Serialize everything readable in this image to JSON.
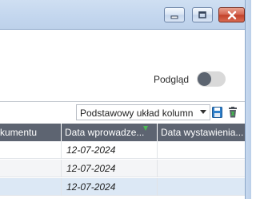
{
  "window": {
    "controls": [
      "minimize",
      "maximize",
      "close"
    ]
  },
  "preview": {
    "label": "Podgląd",
    "enabled": false
  },
  "grid_toolbar": {
    "layout_selected": "Podstawowy układ kolumn",
    "icons": [
      "save-icon",
      "delete-icon"
    ]
  },
  "table": {
    "columns": [
      "kumentu",
      "Data wprowadze...",
      "Data wystawienia..."
    ],
    "sorted_column": "Data wprowadze...",
    "rows": [
      {
        "doc": "",
        "entry_date": "12-07-2024",
        "issue_date": ""
      },
      {
        "doc": "",
        "entry_date": "12-07-2024",
        "issue_date": ""
      },
      {
        "doc": "",
        "entry_date": "12-07-2024",
        "issue_date": ""
      }
    ]
  },
  "colors": {
    "header_bg": "#5d6471",
    "selected_row": "#dce8f5",
    "sort_indicator": "#4cbb54"
  }
}
